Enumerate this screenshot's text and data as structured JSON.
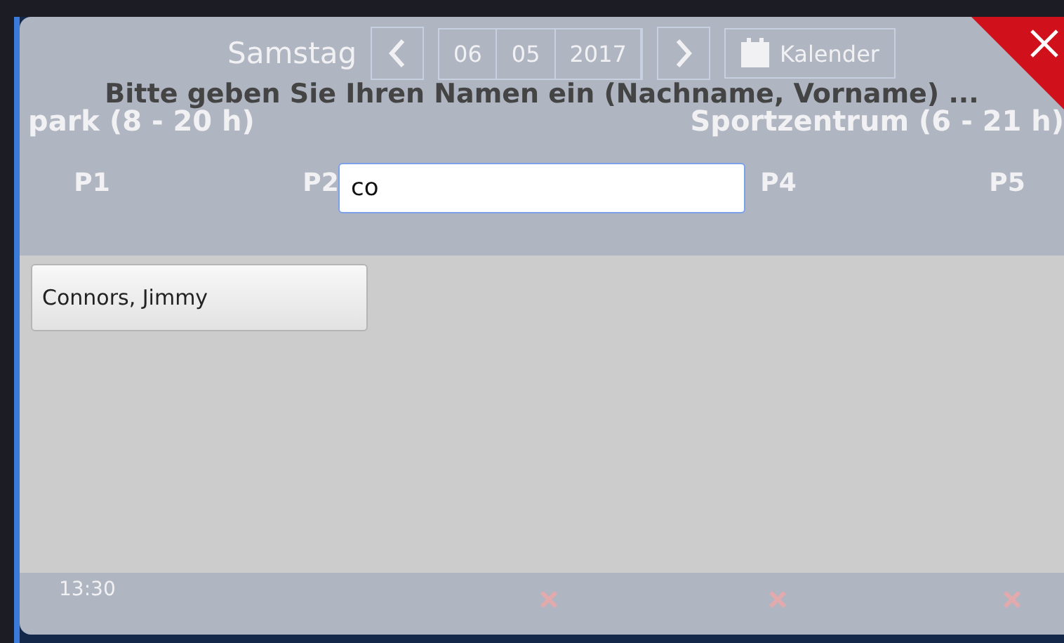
{
  "background": {
    "day": "Samstag",
    "date": [
      "06",
      "05",
      "2017"
    ],
    "calendar_button": "Kalender",
    "venues": [
      "park (8 - 20 h)",
      "Sportzentrum (6 - 21 h)"
    ],
    "courts": [
      "P1",
      "P2",
      "P4",
      "P5"
    ],
    "time": "13:30"
  },
  "dialog": {
    "title": "Bitte geben Sie Ihren Namen ein (Nachname, Vorname) ...",
    "search": {
      "value": "co"
    },
    "results": [
      {
        "name": "Connors, Jimmy"
      }
    ]
  }
}
